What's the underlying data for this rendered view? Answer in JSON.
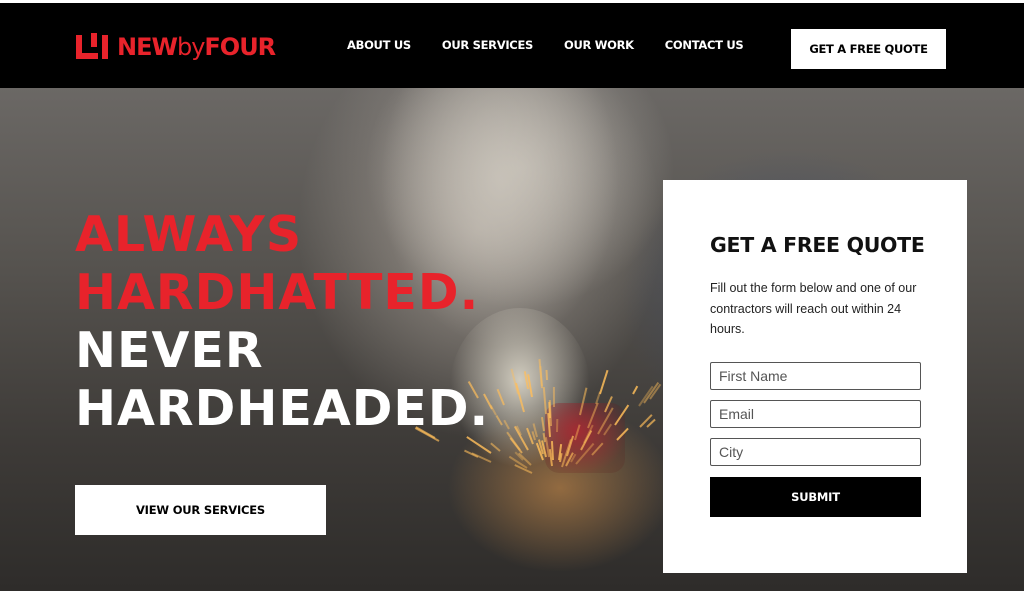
{
  "header": {
    "logo": {
      "text_new": "NEW",
      "text_by": "by",
      "text_four": "FOUR"
    },
    "nav": [
      {
        "label": "ABOUT US"
      },
      {
        "label": "OUR SERVICES"
      },
      {
        "label": "OUR WORK"
      },
      {
        "label": "CONTACT US"
      }
    ],
    "cta_label": "GET A FREE QUOTE"
  },
  "hero": {
    "headline_line1": "ALWAYS",
    "headline_line2": "HARDHATTED.",
    "headline_line3": "NEVER",
    "headline_line4": "HARDHEADED.",
    "button_label": "VIEW OUR SERVICES"
  },
  "quote_form": {
    "title": "GET A FREE QUOTE",
    "description": "Fill out the form below and one of our contractors will reach out within 24 hours.",
    "fields": [
      {
        "placeholder": "First Name",
        "value": ""
      },
      {
        "placeholder": "Email",
        "value": ""
      },
      {
        "placeholder": "City",
        "value": ""
      }
    ],
    "submit_label": "SUBMIT"
  },
  "colors": {
    "brand_red": "#e8232b",
    "nav_background": "#000000",
    "button_white": "#ffffff",
    "submit_black": "#000000"
  }
}
